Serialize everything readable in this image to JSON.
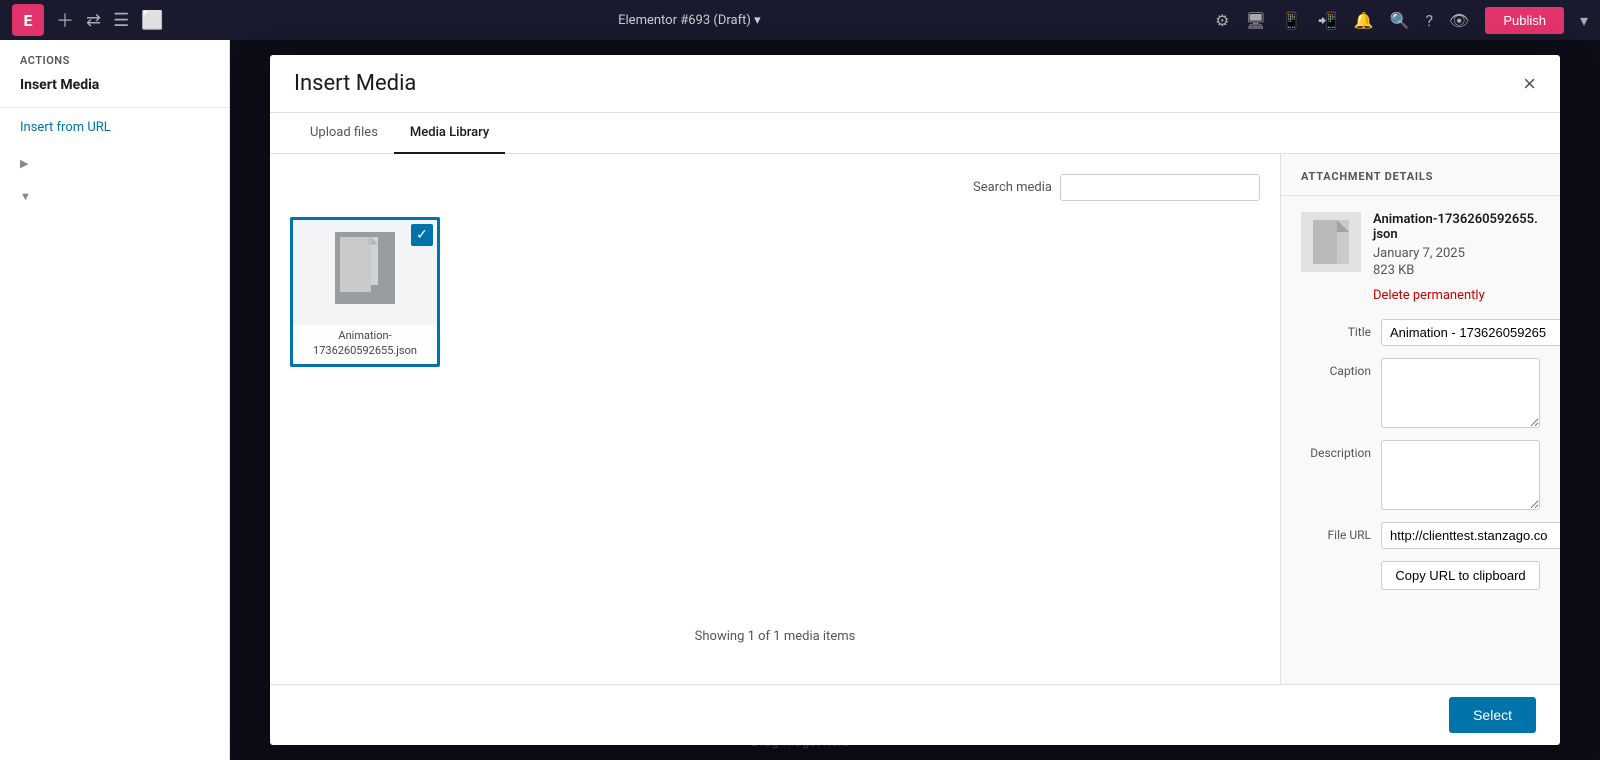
{
  "toolbar": {
    "logo": "E",
    "title": "Elementor #693",
    "draft": "(Draft)",
    "publish_label": "Publish",
    "icons": [
      "plus",
      "layers",
      "stack",
      "square"
    ]
  },
  "sidebar": {
    "section_label": "Actions",
    "insert_media_label": "Insert Media",
    "insert_url_label": "Insert from URL",
    "arrows": [
      "▶",
      "▼"
    ]
  },
  "modal": {
    "title": "Insert Media",
    "close_icon": "×",
    "tabs": [
      {
        "label": "Upload files",
        "active": false
      },
      {
        "label": "Media Library",
        "active": true
      }
    ],
    "search": {
      "label": "Search media",
      "placeholder": ""
    },
    "media_items": [
      {
        "name": "Animation-1736260592655.json",
        "label_line1": "Animation-",
        "label_line2": "1736260592655.json",
        "selected": true
      }
    ],
    "status_text": "Showing 1 of 1 media items",
    "attachment_details": {
      "header": "ATTACHMENT DETAILS",
      "filename": "Animation-1736260592655.json",
      "date": "January 7, 2025",
      "size": "823 KB",
      "delete_label": "Delete permanently",
      "title_label": "Title",
      "title_value": "Animation - 173626059265",
      "caption_label": "Caption",
      "caption_value": "",
      "description_label": "Description",
      "description_value": "",
      "file_url_label": "File URL",
      "file_url_value": "http://clienttest.stanzago.co",
      "copy_url_label": "Copy URL to clipboard"
    },
    "footer": {
      "select_label": "Select"
    }
  },
  "bg": {
    "drag_text": "Drag widget here"
  }
}
